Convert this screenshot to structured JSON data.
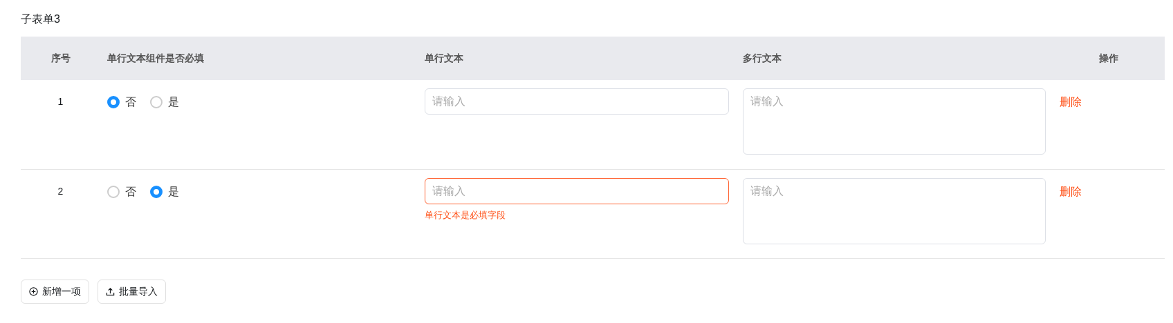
{
  "title": "子表单3",
  "columns": [
    "序号",
    "单行文本组件是否必填",
    "单行文本",
    "多行文本",
    "操作"
  ],
  "rows": [
    {
      "index": "1",
      "required": [
        {
          "label": "否",
          "selected": true
        },
        {
          "label": "是",
          "selected": false
        }
      ],
      "single_text": {
        "placeholder": "请输入",
        "invalid": false
      },
      "multi_text": {
        "placeholder": "请输入"
      },
      "action": "删除"
    },
    {
      "index": "2",
      "required": [
        {
          "label": "否",
          "selected": false
        },
        {
          "label": "是",
          "selected": true
        }
      ],
      "single_text": {
        "placeholder": "请输入",
        "invalid": true,
        "error": "单行文本是必填字段"
      },
      "multi_text": {
        "placeholder": "请输入"
      },
      "action": "删除"
    }
  ],
  "buttons": [
    {
      "label": "新增一项",
      "kind": "add"
    },
    {
      "label": "批量导入",
      "kind": "import"
    }
  ]
}
